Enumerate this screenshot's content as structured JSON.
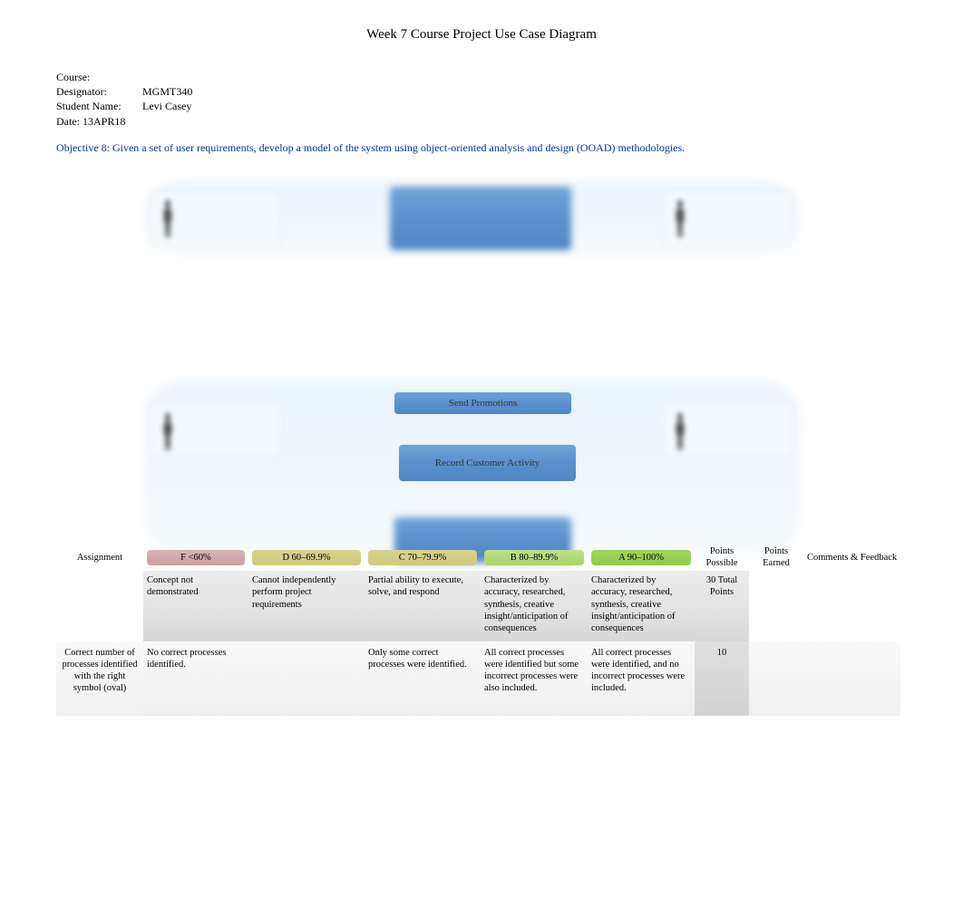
{
  "title": "Week 7 Course Project Use Case Diagram",
  "header": {
    "course_label": "Course: Designator:",
    "course_value": "MGMT340",
    "student_label": "Student Name:",
    "student_value": "Levi Casey",
    "date_label": "Date:",
    "date_value": "13APR18"
  },
  "objective": "Objective 8: Given a set of user requirements, develop a model of the system using object-oriented analysis and design (OOAD) methodologies.",
  "diagram": {
    "send_promotions": "Send Promotions",
    "record_activity": "Record Customer Activity"
  },
  "rubric": {
    "headers": {
      "assignment": "Assignment",
      "f": "F <60%",
      "d": "D 60–69.9%",
      "c": "C 70–79.9%",
      "b": "B 80–89.9%",
      "a": "A 90–100%",
      "points_possible": "Points Possible",
      "points_earned": "Points Earned",
      "comments": "Comments & Feedback"
    },
    "descriptors": {
      "f": "Concept not demonstrated",
      "d": "Cannot independently perform project requirements",
      "c": "Partial ability to execute, solve, and respond",
      "b": "Characterized by accuracy, researched, synthesis, creative insight/anticipation of consequences",
      "a": "Characterized by accuracy, researched, synthesis, creative insight/anticipation of consequences",
      "points_possible": "30 Total Points"
    },
    "rows": [
      {
        "assignment": "Correct number of processes identified with the right symbol (oval)",
        "f": "No correct processes identified.",
        "d": "",
        "c": "Only some correct processes were identified.",
        "b": "All correct processes were identified but some incorrect processes were also included.",
        "a": "All correct processes were identified, and no incorrect processes were included.",
        "points_possible": "10",
        "points_earned": "",
        "comments": ""
      }
    ]
  }
}
